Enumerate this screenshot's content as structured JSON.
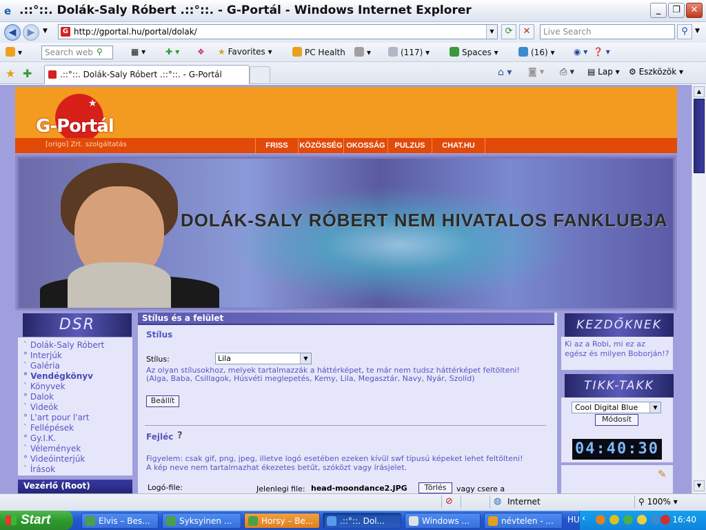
{
  "window": {
    "title": ".::°::. Dolák-Saly Róbert .::°::. - G-Portál - Windows Internet Explorer",
    "minimize": "_",
    "maximize": "❐",
    "close": "✕"
  },
  "address_bar": {
    "url": "http://gportal.hu/portal/dolak/",
    "search_placeholder": "Live Search"
  },
  "toolbar2": {
    "search_placeholder": "Search web",
    "favorites": "Favorites",
    "pc_health": "PC Health",
    "mail_count": "(117)",
    "spaces": "Spaces",
    "contacts_count": "(16)"
  },
  "tabs": {
    "active_tab": ".::°::. Dolák-Saly Róbert .::°::. - G-Portál",
    "page_label": "Lap",
    "tools_label": "Eszközök"
  },
  "gportal": {
    "logo_text": "G-Portál",
    "origo_text": "[origo] Zrt. szolgáltatás",
    "nav": [
      "FRISS",
      "KÖZÖSSÉG",
      "OKOSSÁG",
      "PULZUS",
      "CHAT.HU"
    ]
  },
  "banner": {
    "title": "DOLÁK-SALY RÓBERT NEM HIVATALOS FANKLUBJA"
  },
  "left": {
    "box_title": "DSR",
    "menu": [
      {
        "label": "Dolák-Saly Róbert",
        "bullet": "`",
        "bold": false
      },
      {
        "label": "Interjúk",
        "bullet": "°",
        "bold": false
      },
      {
        "label": "Galéria",
        "bullet": "`",
        "bold": false
      },
      {
        "label": "Vendégkönyv",
        "bullet": "°",
        "bold": true
      },
      {
        "label": "Könyvek",
        "bullet": "`",
        "bold": false
      },
      {
        "label": "Dalok",
        "bullet": "°",
        "bold": false
      },
      {
        "label": "Videók",
        "bullet": "`",
        "bold": false
      },
      {
        "label": "L'art pour l'art",
        "bullet": "°",
        "bold": false
      },
      {
        "label": "Fellépések",
        "bullet": "`",
        "bold": false
      },
      {
        "label": "Gy.I.K.",
        "bullet": "°",
        "bold": false
      },
      {
        "label": "Vélemények",
        "bullet": "`",
        "bold": false
      },
      {
        "label": "Videóinterjúk",
        "bullet": "°",
        "bold": false
      },
      {
        "label": "Írások",
        "bullet": "`",
        "bold": false
      }
    ],
    "control_header": "Vezérlő (Root)"
  },
  "main": {
    "header": "Stílus és a felület",
    "style_section": "Stílus",
    "style_label": "Stílus:",
    "style_value": "Lila",
    "style_note_1": "Az olyan stílusokhoz, melyek tartalmazzák a háttérképet, te már nem tudsz háttérképet feltölteni!",
    "style_note_2": "(Alga, Baba, Csillagok, Húsvéti meglepetés, Kemy, Lila, Megasztár, Navy, Nyár, Szolíd)",
    "apply_button": "Beállít",
    "header_section": "Fejléc",
    "help": "?",
    "warning_1": "Figyelem: csak gif, png, jpeg, illetve logó esetében ezeken kívül swf típusú képeket lehet feltölteni!",
    "warning_2": "A kép neve nem tartalmazhat ékezetes betűt, szóközt vagy írásjelet.",
    "logo_file_label": "Logó-file:",
    "current_file_label": "Jelenlegi file:",
    "current_file": "head-moondance2.JPG",
    "delete_button": "Törlés",
    "or_replace": "vagy csere a"
  },
  "right": {
    "box1_title": "KEZDŐKNEK",
    "box1_text": "Ki az a Robi, mi ez az egész és milyen Boborján!?",
    "box2_title": "TIKK-TAKK",
    "clock_style": "Cool Digital Blue",
    "modify_button": "Módosít",
    "clock_time": "04:40:30"
  },
  "status": {
    "zone": "Internet",
    "zoom": "100%"
  },
  "taskbar": {
    "start": "Start",
    "tasks": [
      "Elvis – Bes...",
      "Syksyinen ...",
      "Horsy – Be...",
      ".::°::. Dol...",
      "Windows ...",
      "névtelen - ..."
    ],
    "lang": "HU",
    "clock": "16:40"
  }
}
